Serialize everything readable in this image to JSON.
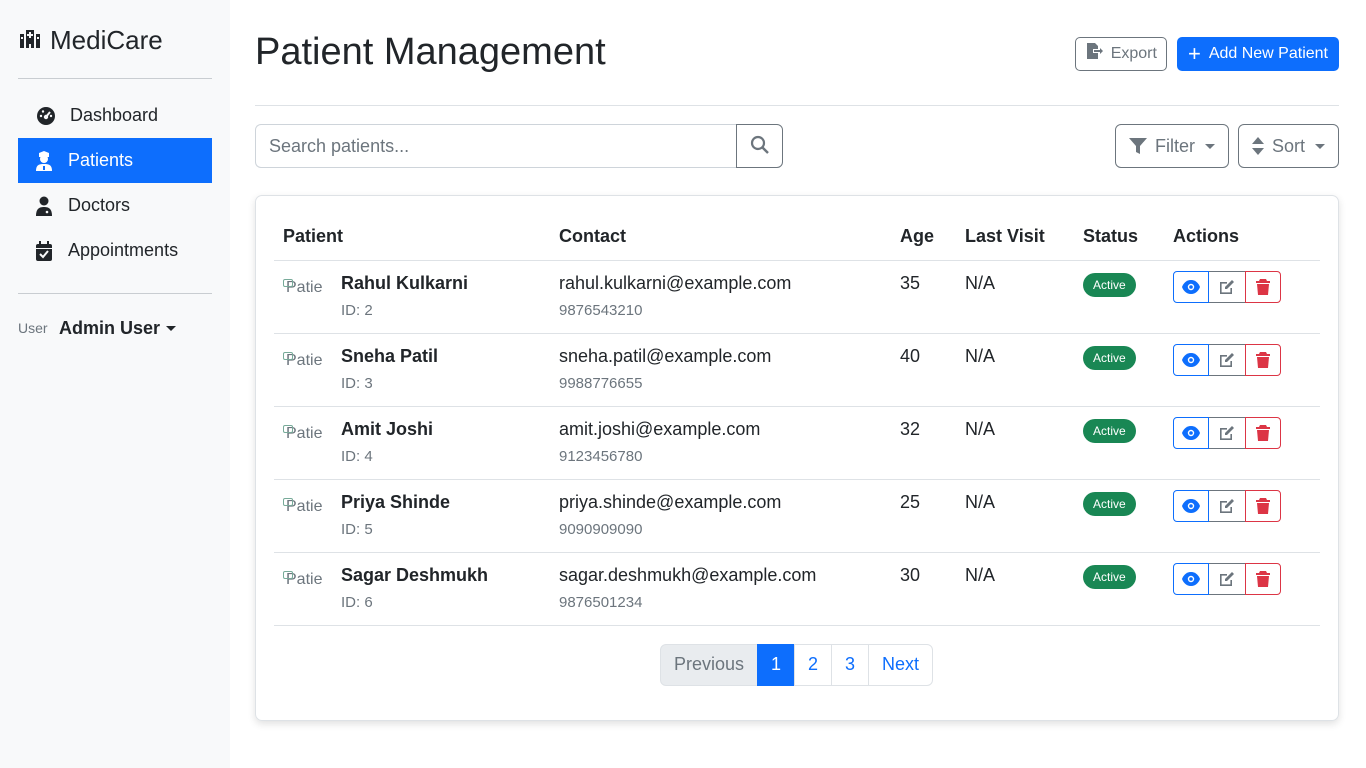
{
  "brand": {
    "name": "MediCare",
    "icon": "hospital-icon"
  },
  "sidebar": {
    "items": [
      {
        "label": "Dashboard",
        "icon": "gauge-icon"
      },
      {
        "label": "Patients",
        "icon": "user-nurse-icon",
        "active": true
      },
      {
        "label": "Doctors",
        "icon": "user-doctor-icon"
      },
      {
        "label": "Appointments",
        "icon": "calendar-check-icon"
      }
    ],
    "user": {
      "avatar_alt": "User",
      "name": "Admin User"
    }
  },
  "header": {
    "title": "Patient Management",
    "export_label": "Export",
    "add_label": "Add New Patient"
  },
  "toolbar": {
    "search_placeholder": "Search patients...",
    "filter_label": "Filter",
    "sort_label": "Sort"
  },
  "table": {
    "headers": [
      "Patient",
      "Contact",
      "Age",
      "Last Visit",
      "Status",
      "Actions"
    ],
    "rows": [
      {
        "img_alt": "Patient",
        "name": "Rahul Kulkarni",
        "id": "ID: 2",
        "email": "rahul.kulkarni@example.com",
        "phone": "9876543210",
        "age": "35",
        "last_visit": "N/A",
        "status": "Active"
      },
      {
        "img_alt": "Patient",
        "name": "Sneha Patil",
        "id": "ID: 3",
        "email": "sneha.patil@example.com",
        "phone": "9988776655",
        "age": "40",
        "last_visit": "N/A",
        "status": "Active"
      },
      {
        "img_alt": "Patient",
        "name": "Amit Joshi",
        "id": "ID: 4",
        "email": "amit.joshi@example.com",
        "phone": "9123456780",
        "age": "32",
        "last_visit": "N/A",
        "status": "Active"
      },
      {
        "img_alt": "Patient",
        "name": "Priya Shinde",
        "id": "ID: 5",
        "email": "priya.shinde@example.com",
        "phone": "9090909090",
        "age": "25",
        "last_visit": "N/A",
        "status": "Active"
      },
      {
        "img_alt": "Patient",
        "name": "Sagar Deshmukh",
        "id": "ID: 6",
        "email": "sagar.deshmukh@example.com",
        "phone": "9876501234",
        "age": "30",
        "last_visit": "N/A",
        "status": "Active"
      }
    ]
  },
  "pagination": {
    "previous": "Previous",
    "pages": [
      "1",
      "2",
      "3"
    ],
    "current": "1",
    "next": "Next"
  },
  "colors": {
    "primary": "#0d6efd",
    "success": "#198754",
    "danger": "#dc3545",
    "secondary": "#6c757d"
  }
}
